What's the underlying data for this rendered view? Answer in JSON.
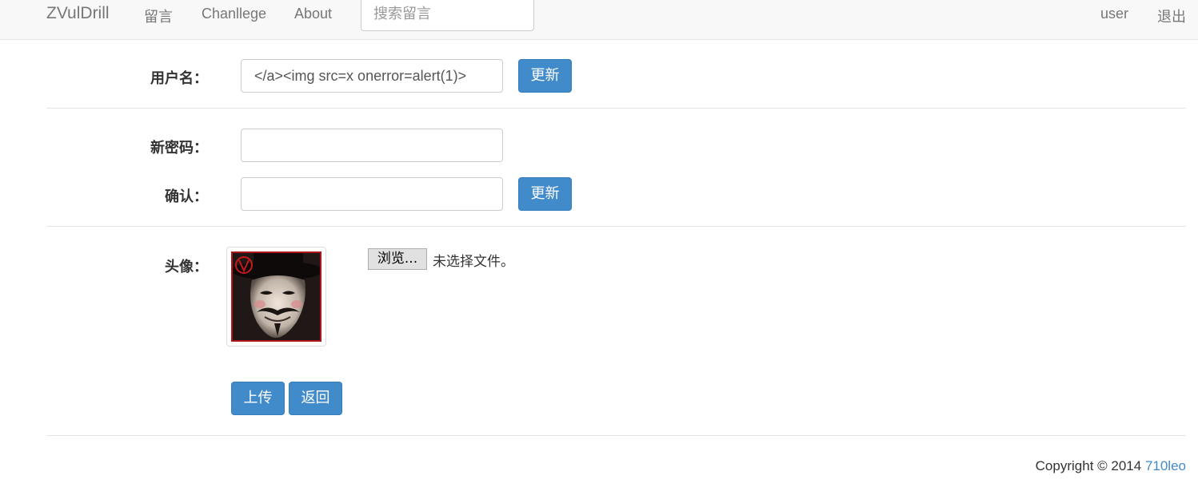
{
  "navbar": {
    "brand": "ZVulDrill",
    "links": [
      "留言",
      "Chanllege",
      "About"
    ],
    "search_placeholder": "搜索留言",
    "user": "user",
    "logout": "退出"
  },
  "username_section": {
    "label": "用户名：",
    "value": "</a><img src=x onerror=alert(1)>",
    "button": "更新"
  },
  "password_section": {
    "new_label": "新密码：",
    "new_value": "",
    "confirm_label": "确认：",
    "confirm_value": "",
    "button": "更新"
  },
  "avatar_section": {
    "label": "头像：",
    "browse_button": "浏览...",
    "file_status": "未选择文件。",
    "upload_button": "上传",
    "back_button": "返回"
  },
  "footer": {
    "copyright": "Copyright © 2014 ",
    "author": "710leo"
  },
  "colors": {
    "primary": "#428bca",
    "navbar_bg": "#f8f8f8",
    "avatar_border": "#b0151c"
  }
}
